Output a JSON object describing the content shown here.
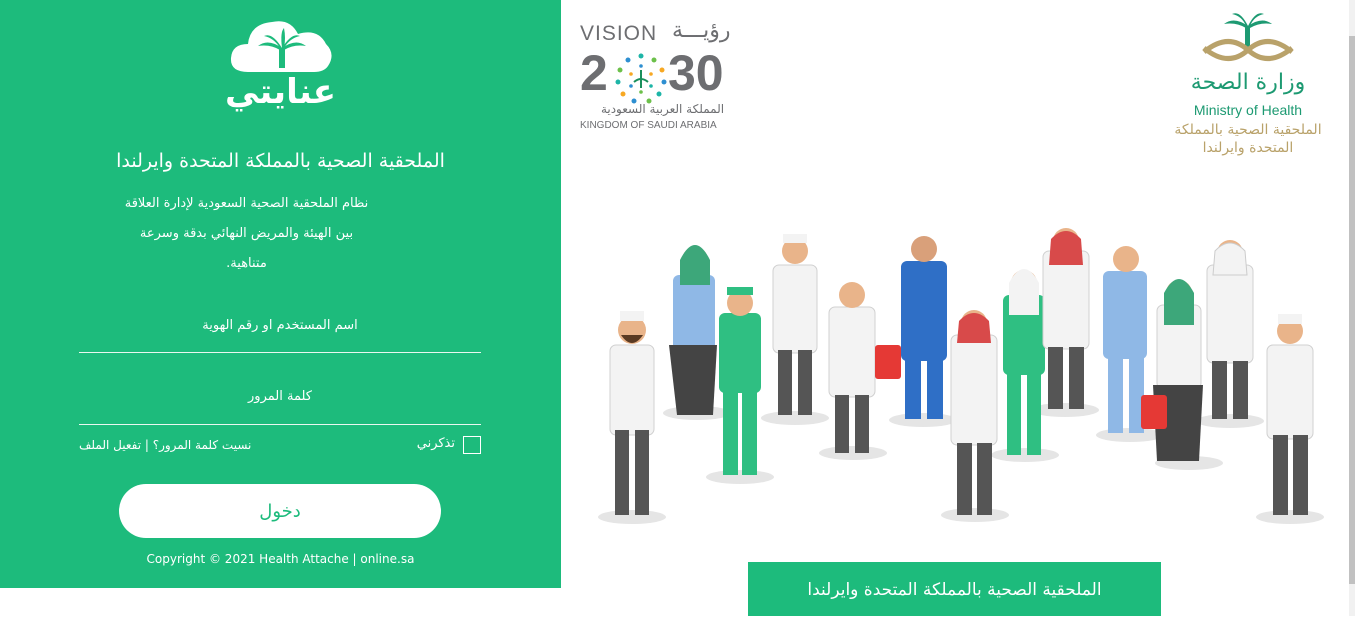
{
  "brand": {
    "logo_text": "عنايتي"
  },
  "panel": {
    "title": "الملحقية الصحية بالمملكة المتحدة وايرلندا",
    "description": [
      "نظام الملحقية الصحية السعودية لإدارة العلاقة",
      "بين الهيئة والمريض النهائي بدقة وسرعة",
      "متناهية."
    ],
    "username_label": "اسم المستخدم او رقم الهوية",
    "password_label": "كلمة المرور",
    "remember_label": "تذكرني",
    "forgot_link": "نسيت كلمة المرور؟ | تفعيل الملف",
    "login_button": "دخول",
    "copyright": "Copyright © 2021 Health Attache | online.sa"
  },
  "vision": {
    "vision_en": "VISION",
    "vision_ar": "رؤيـــة",
    "year_left": "2",
    "year_right": "30",
    "kingdom_ar": "المملكة العربية السعودية",
    "kingdom_en": "KINGDOM OF SAUDI ARABIA"
  },
  "ministry": {
    "name_ar": "وزارة الصحة",
    "name_en": "Ministry of Health",
    "sub_ar_1": "الملحقية الصحية بالمملكة",
    "sub_ar_2": "المتحدة وايرلندا"
  },
  "bottom_bar": {
    "text": "الملحقية الصحية بالمملكة المتحدة وايرلندا"
  },
  "colors": {
    "primary": "#1dbb7c",
    "gold": "#b9a26a",
    "moh_green": "#1d9a72"
  },
  "icons": [
    "cloud-palm-logo-icon",
    "vision-2030-logo",
    "ministry-of-health-logo",
    "medical-staff-illustration"
  ]
}
